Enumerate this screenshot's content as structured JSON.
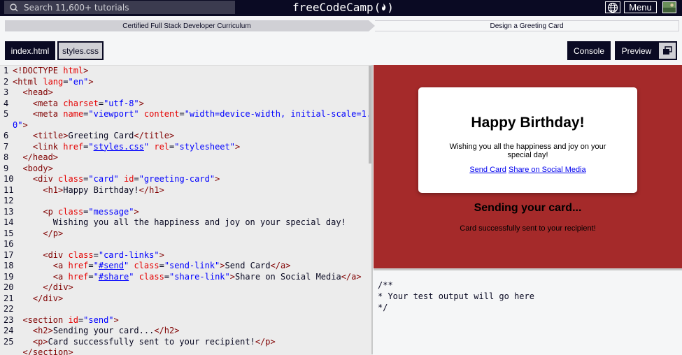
{
  "nav": {
    "search_placeholder": "Search 11,600+ tutorials",
    "logo_text": "freeCodeCamp",
    "menu_label": "Menu"
  },
  "breadcrumb": {
    "curriculum": "Certified Full Stack Developer Curriculum",
    "lesson": "Design a Greeting Card"
  },
  "toolbar": {
    "tab_index": "index.html",
    "tab_styles": "styles.css",
    "console_label": "Console",
    "preview_label": "Preview"
  },
  "editor": {
    "line_numbers": [
      "1",
      "2",
      "3",
      "4",
      "5",
      "",
      "6",
      "7",
      "8",
      "9",
      "10",
      "11",
      "12",
      "13",
      "14",
      "15",
      "16",
      "17",
      "18",
      "19",
      "20",
      "21",
      "22",
      "23",
      "24",
      "25",
      ""
    ]
  },
  "preview": {
    "card_title": "Happy Birthday!",
    "card_message": "Wishing you all the happiness and joy on your special day!",
    "send_link": "Send Card",
    "share_link": "Share on Social Media",
    "section_heading": "Sending your card...",
    "section_text": "Card successfully sent to your recipient!"
  },
  "console": {
    "lines": [
      "/**",
      "* Your test output will go here",
      "*/"
    ]
  },
  "colors": {
    "nav_bg": "#0a0a23",
    "preview_bg": "#a52a2a",
    "tag": "#800000",
    "attr": "#e50000",
    "value": "#0000ff"
  }
}
